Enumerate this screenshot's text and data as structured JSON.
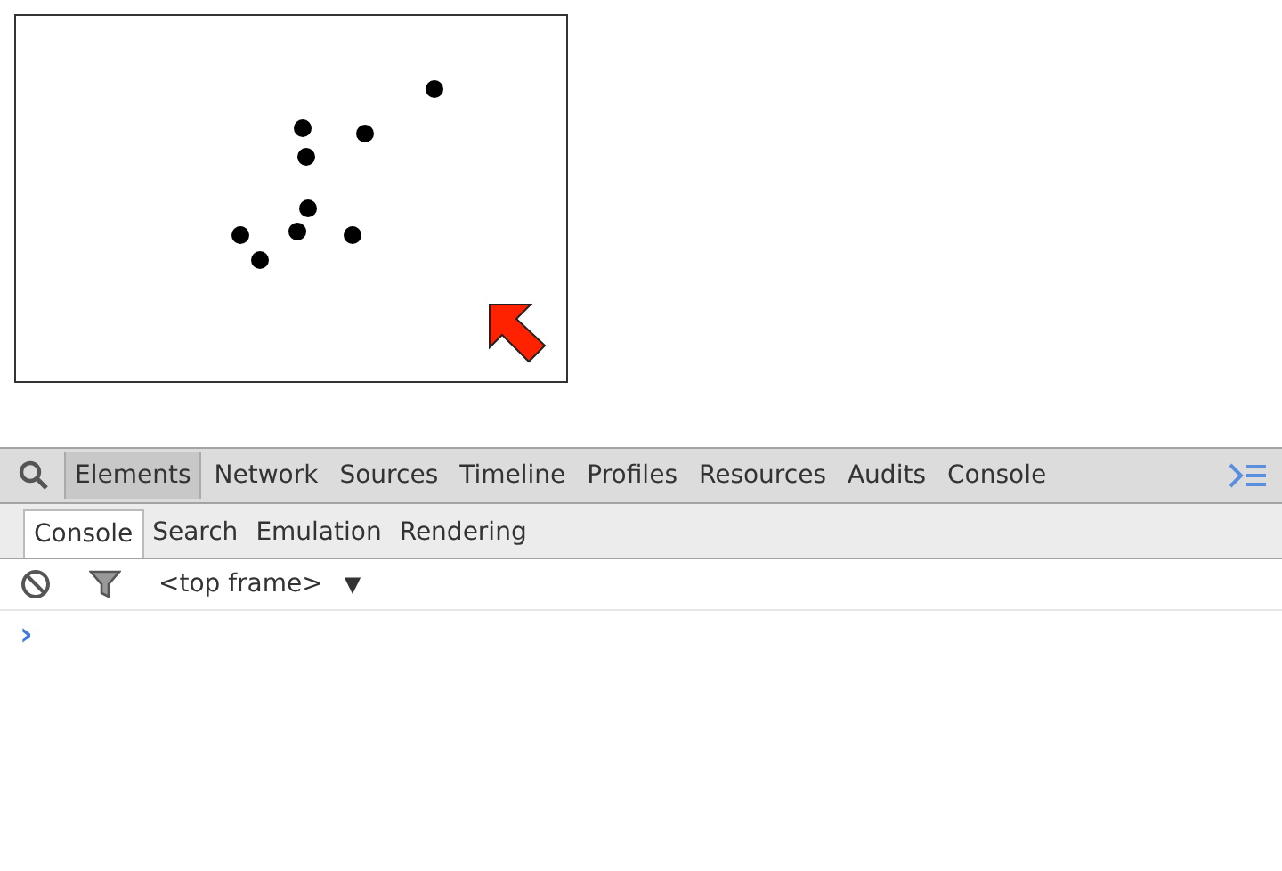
{
  "panel_tabs": [
    {
      "label": "Elements",
      "selected": true
    },
    {
      "label": "Network",
      "selected": false
    },
    {
      "label": "Sources",
      "selected": false
    },
    {
      "label": "Timeline",
      "selected": false
    },
    {
      "label": "Profiles",
      "selected": false
    },
    {
      "label": "Resources",
      "selected": false
    },
    {
      "label": "Audits",
      "selected": false
    },
    {
      "label": "Console",
      "selected": false
    }
  ],
  "drawer_tabs": [
    {
      "label": "Console",
      "selected": true
    },
    {
      "label": "Search",
      "selected": false
    },
    {
      "label": "Emulation",
      "selected": false
    },
    {
      "label": "Rendering",
      "selected": false
    }
  ],
  "console_toolbar": {
    "frame_selector": "<top frame>",
    "dropdown_arrow": "▼"
  },
  "prompt": "›"
}
